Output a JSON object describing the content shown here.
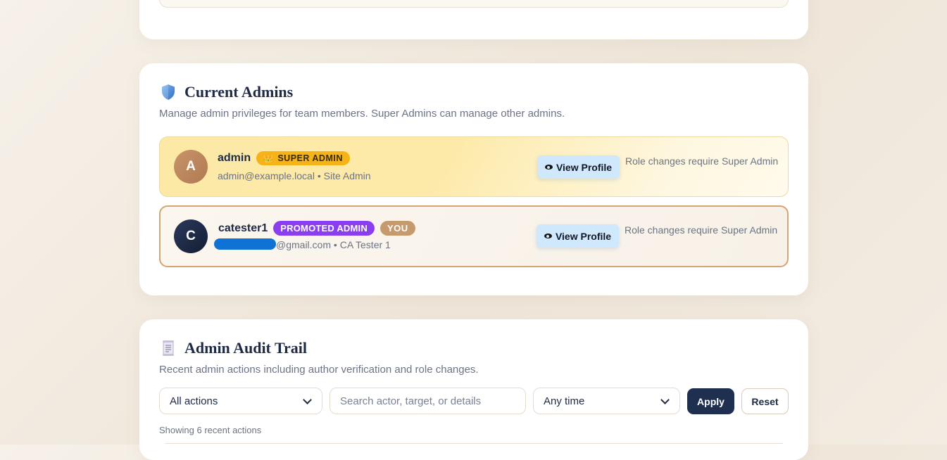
{
  "admins_section": {
    "title": "Current Admins",
    "description": "Manage admin privileges for team members. Super Admins can manage other admins.",
    "icon": "shield-icon",
    "accent": "#4a90e2",
    "admins": [
      {
        "initial": "A",
        "username": "admin",
        "badge": "SUPER ADMIN",
        "badge_icon": "crown-icon",
        "badge_color": "#f6b318",
        "email": "admin@example.local",
        "separator": "•",
        "role": "Site Admin",
        "view_button": "View Profile",
        "note": "Role changes require Super Admin"
      },
      {
        "initial": "C",
        "username": "catester1",
        "badge": "PROMOTED ADMIN",
        "badge_color": "#8b3df0",
        "you_badge": "YOU",
        "email_visible": "@gmail.com",
        "separator": "•",
        "role": "CA Tester 1",
        "view_button": "View Profile",
        "note": "Role changes require Super Admin"
      }
    ]
  },
  "audit_section": {
    "title": "Admin Audit Trail",
    "description": "Recent admin actions including author verification and role changes.",
    "icon": "scroll-icon",
    "filters": {
      "action_selected": "All actions",
      "search_placeholder": "Search actor, target, or details",
      "time_selected": "Any time"
    },
    "apply_label": "Apply",
    "reset_label": "Reset",
    "showing": "Showing 6 recent actions"
  }
}
